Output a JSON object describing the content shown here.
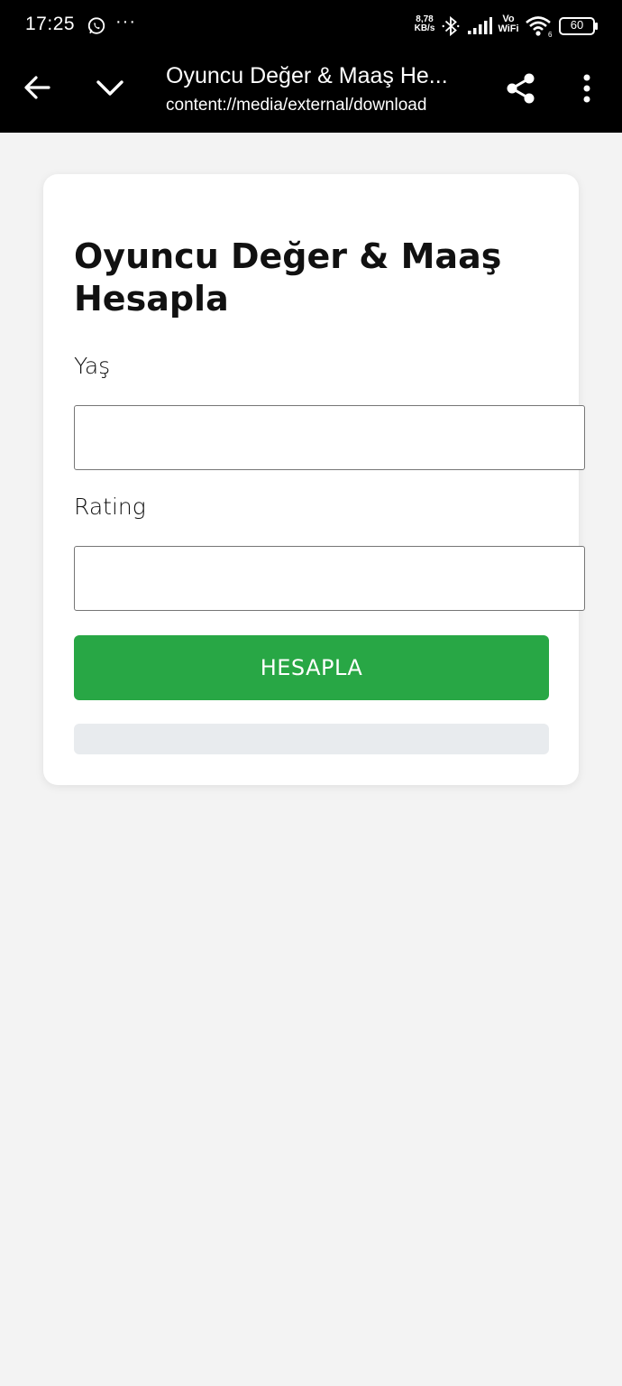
{
  "status_bar": {
    "time": "17:25",
    "more": "···",
    "net_speed_value": "8,78",
    "net_speed_unit": "KB/s",
    "vowifi_top": "Vo",
    "vowifi_bottom": "WiFi",
    "battery": "60",
    "icons": [
      "whatsapp-icon",
      "bluetooth-icon",
      "signal-icon",
      "wifi-icon",
      "battery-icon"
    ]
  },
  "toolbar": {
    "title": "Oyuncu Değer & Maaş He...",
    "url": "content://media/external/download",
    "icons": [
      "back-arrow-icon",
      "chevron-down-icon",
      "share-icon",
      "more-vert-icon"
    ]
  },
  "form": {
    "title": "Oyuncu Değer & Maaş Hesapla",
    "age_label": "Yaş",
    "age_value": "",
    "rating_label": "Rating",
    "rating_value": "",
    "submit_label": "HESAPLA",
    "result": ""
  },
  "colors": {
    "submit_button": "#28a745",
    "background": "#f3f3f3",
    "result_box": "#e8ebee"
  }
}
